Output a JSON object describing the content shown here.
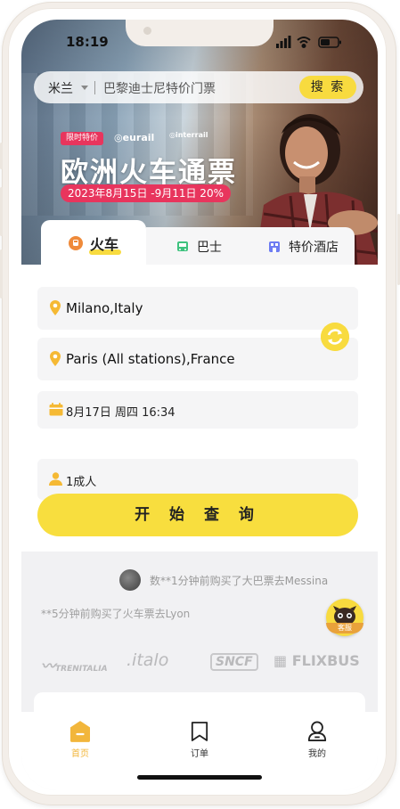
{
  "status_bar": {
    "time": "18:19"
  },
  "search": {
    "city": "米兰",
    "placeholder": "巴黎迪士尼特价门票",
    "button": "搜 索"
  },
  "banner": {
    "tag": "限时特价",
    "brands": [
      "eurail",
      "interrail"
    ],
    "title": "欧洲火车通票",
    "date_range": "2023年8月15日 -9月11日 20%"
  },
  "tabs": [
    {
      "label": "火车",
      "icon": "train-icon"
    },
    {
      "label": "巴士",
      "icon": "bus-icon"
    },
    {
      "label": "特价酒店",
      "icon": "hotel-icon"
    }
  ],
  "form": {
    "from": "Milano,Italy",
    "to": "Paris (All stations),France",
    "date": "8月17日 周四 16:34",
    "passengers": "1成人",
    "submit": "开 始 查 询"
  },
  "feed": [
    "数**1分钟前购买了大巴票去Messina",
    "**5分钟前购买了火车票去Lyon"
  ],
  "customer_service": {
    "label": "客服"
  },
  "partner_logos": [
    "TRENITALIA",
    ".italo",
    "SNCF",
    "FLIXBUS"
  ],
  "bottom_nav": [
    {
      "label": "首页",
      "icon": "home-icon",
      "active": true
    },
    {
      "label": "订单",
      "icon": "orders-icon",
      "active": false
    },
    {
      "label": "我的",
      "icon": "profile-icon",
      "active": false
    }
  ],
  "colors": {
    "accent": "#f8db3f",
    "promo_pink": "#e8355d",
    "nav_active": "#f2b63b"
  }
}
